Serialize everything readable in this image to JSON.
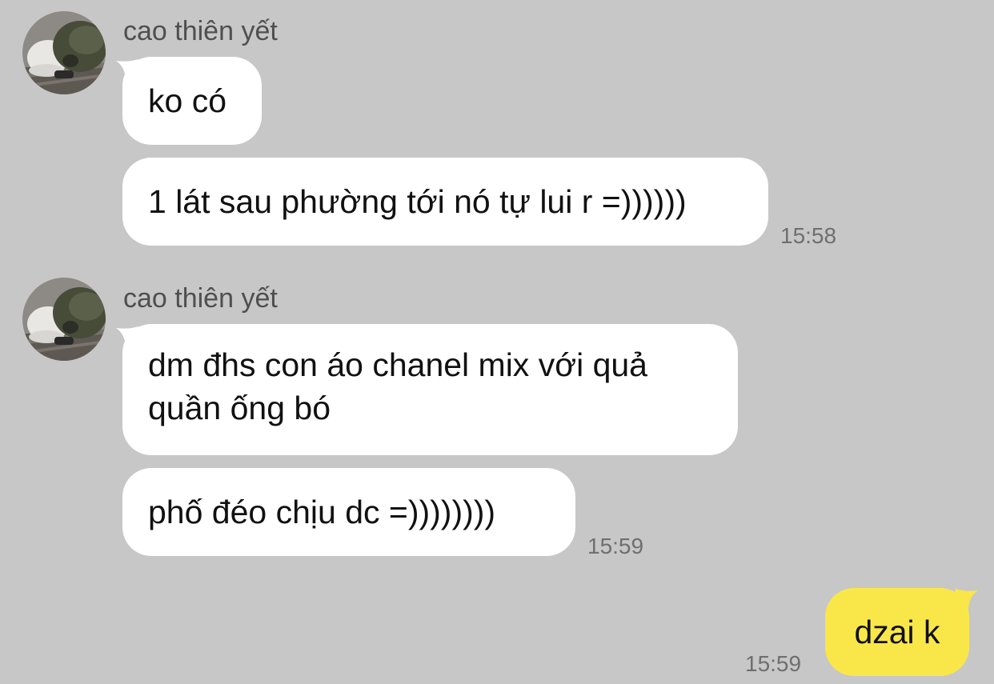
{
  "conversation": {
    "groups": [
      {
        "sender": "cao thiên yết",
        "messages": [
          "ko có",
          "1 lát sau phường tới nó tự lui r =))))))"
        ],
        "time": "15:58"
      },
      {
        "sender": "cao thiên yết",
        "messages": [
          "dm đhs con áo chanel mix với quả\nquần ống bó",
          "phố đéo chịu dc =))))))))"
        ],
        "time": "15:59"
      }
    ],
    "outgoing": {
      "message": "dzai k",
      "time": "15:59"
    }
  },
  "colors": {
    "background": "#c7c7c7",
    "incoming_bubble": "#ffffff",
    "outgoing_bubble": "#f9e74a",
    "sender_text": "#4f4f4f",
    "time_text": "#6f6f6f"
  },
  "icons": {
    "avatar": "avatar-photo"
  }
}
